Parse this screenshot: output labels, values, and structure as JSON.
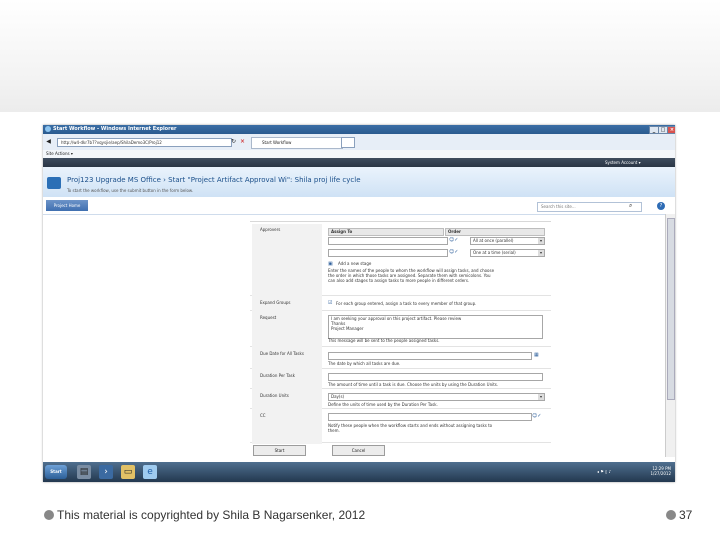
{
  "window": {
    "title": "Start Workflow - Windows Internet Explorer",
    "controls": [
      "_",
      "□",
      "×"
    ]
  },
  "browser": {
    "address": "http://w4-dkr7b7?vqysjie/aep/ShilaDemo3C/Proj12",
    "tab_label": "Start Workflow",
    "links_bar": "Site Actions ▾"
  },
  "sharepoint": {
    "top_right": "System Account ▾",
    "site_title": "Proj123 Upgrade MS Office › Start \"Project Artifact Approval Wi\": Shila proj life cycle",
    "site_subtitle": "To start the workflow, use the submit button in the form below.",
    "nav_tab": "Project Home",
    "search_placeholder": "Search this site...",
    "help": "?"
  },
  "form": {
    "approvers": {
      "label": "Approvers",
      "col_assign": "Assign To",
      "col_order": "Order",
      "order1": "All at once (parallel)",
      "order2": "One at a time (serial)",
      "add_stage": "Add a new stage",
      "help_lines": [
        "Enter the names of the people to whom the workflow will assign tasks, and choose",
        "the order in which those tasks are assigned. Separate them with semicolons. You",
        "can also add stages to assign tasks to more people in different orders."
      ]
    },
    "expand_groups": {
      "label": "Expand Groups",
      "text": "For each group entered, assign a task to every member of that group."
    },
    "request": {
      "label": "Request",
      "lines": [
        "I am seeking your approval on this project artifact.  Please review",
        "Thanks",
        "Project Manager"
      ],
      "hint": "This message will be sent to the people assigned tasks."
    },
    "due_date": {
      "label": "Due Date for All Tasks",
      "hint": "The date by which all tasks are due."
    },
    "duration": {
      "label": "Duration Per Task",
      "hint": "The amount of time until a task is due. Choose the units by using the Duration Units."
    },
    "duration_units": {
      "label": "Duration Units",
      "value": "Day(s)",
      "hint": "Define the units of time used by the Duration Per Task."
    },
    "cc": {
      "label": "CC",
      "hint_lines": [
        "Notify these people when the workflow starts and ends without assigning tasks to",
        "them."
      ]
    },
    "start_button": "Start",
    "cancel_button": "Cancel"
  },
  "taskbar": {
    "start": "Start",
    "clock_time": "12:29 PM",
    "clock_date": "1/27/2012"
  },
  "footer": {
    "copyright": "This material is copyrighted by Shila B Nagarsenker, 2012",
    "page_number": "37"
  }
}
